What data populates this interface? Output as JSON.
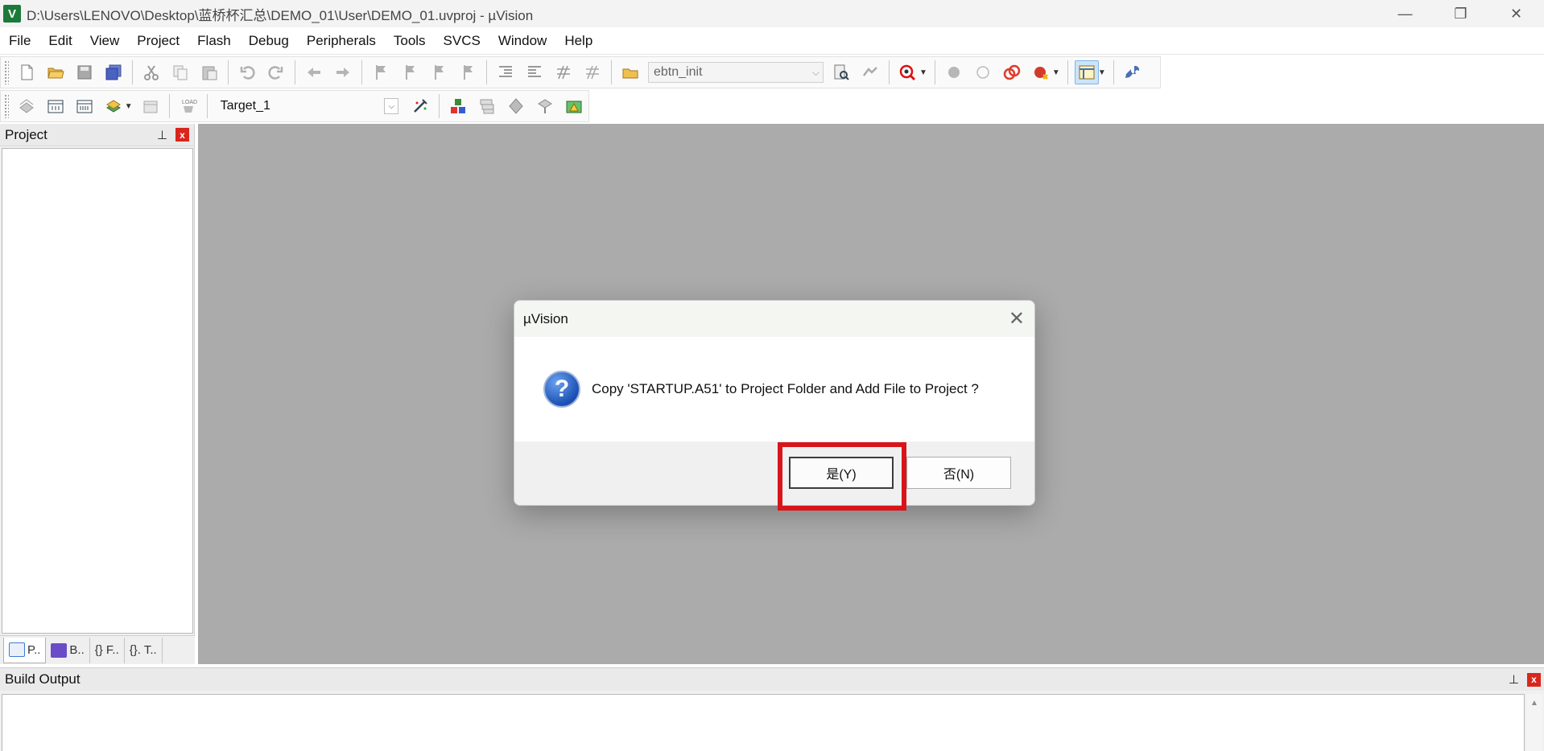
{
  "window": {
    "title": "D:\\Users\\LENOVO\\Desktop\\蓝桥杯汇总\\DEMO_01\\User\\DEMO_01.uvproj - µVision",
    "app_icon_letter": "V",
    "controls": {
      "minimize": "—",
      "restore": "❐",
      "close": "✕"
    }
  },
  "menu": [
    "File",
    "Edit",
    "View",
    "Project",
    "Flash",
    "Debug",
    "Peripherals",
    "Tools",
    "SVCS",
    "Window",
    "Help"
  ],
  "toolbar": {
    "function_combo": "ebtn_init",
    "target_combo": "Target_1",
    "load_label": "LOAD"
  },
  "project_panel": {
    "title": "Project",
    "pin": "📌",
    "close": "x",
    "tabs": [
      {
        "label": "P..",
        "color": "#3a7bd5"
      },
      {
        "label": "B..",
        "color": "#6a4cc8"
      },
      {
        "label": "{} F..",
        "color": "#555555"
      },
      {
        "label": "{}. T..",
        "color": "#2a6ad8"
      }
    ]
  },
  "build_output": {
    "title": "Build Output",
    "pin": "📌",
    "close": "x"
  },
  "dialog": {
    "title": "µVision",
    "close": "✕",
    "message": "Copy 'STARTUP.A51' to Project Folder and Add File to Project ?",
    "icon": "?",
    "yes_label": "是(Y)",
    "no_label": "否(N)"
  },
  "colors": {
    "workspace": "#ababab",
    "highlight": "#d8151a",
    "close_red": "#d9261c"
  }
}
